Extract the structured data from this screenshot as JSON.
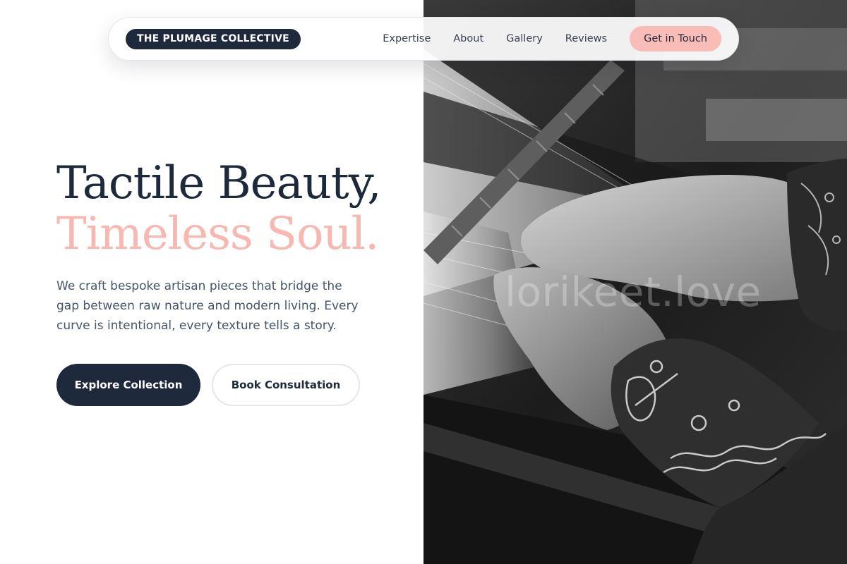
{
  "nav": {
    "brand": "THE PLUMAGE COLLECTIVE",
    "links": [
      "Expertise",
      "About",
      "Gallery",
      "Reviews"
    ],
    "cta": "Get in Touch"
  },
  "hero": {
    "headline_line1": "Tactile Beauty,",
    "headline_line2": "Timeless Soul.",
    "subtitle": "We craft bespoke artisan pieces that bridge the gap between raw nature and modern living. Every curve is intentional, every texture tells a story.",
    "primary_button": "Explore Collection",
    "secondary_button": "Book Consultation"
  },
  "image": {
    "watermark": "lorikeet.love",
    "description_icon": "weaving-hands-photo"
  },
  "colors": {
    "navy": "#1e293b",
    "pink": "#f7b8b2",
    "cta_pink": "#f9bcb7",
    "body_text": "#475569"
  }
}
